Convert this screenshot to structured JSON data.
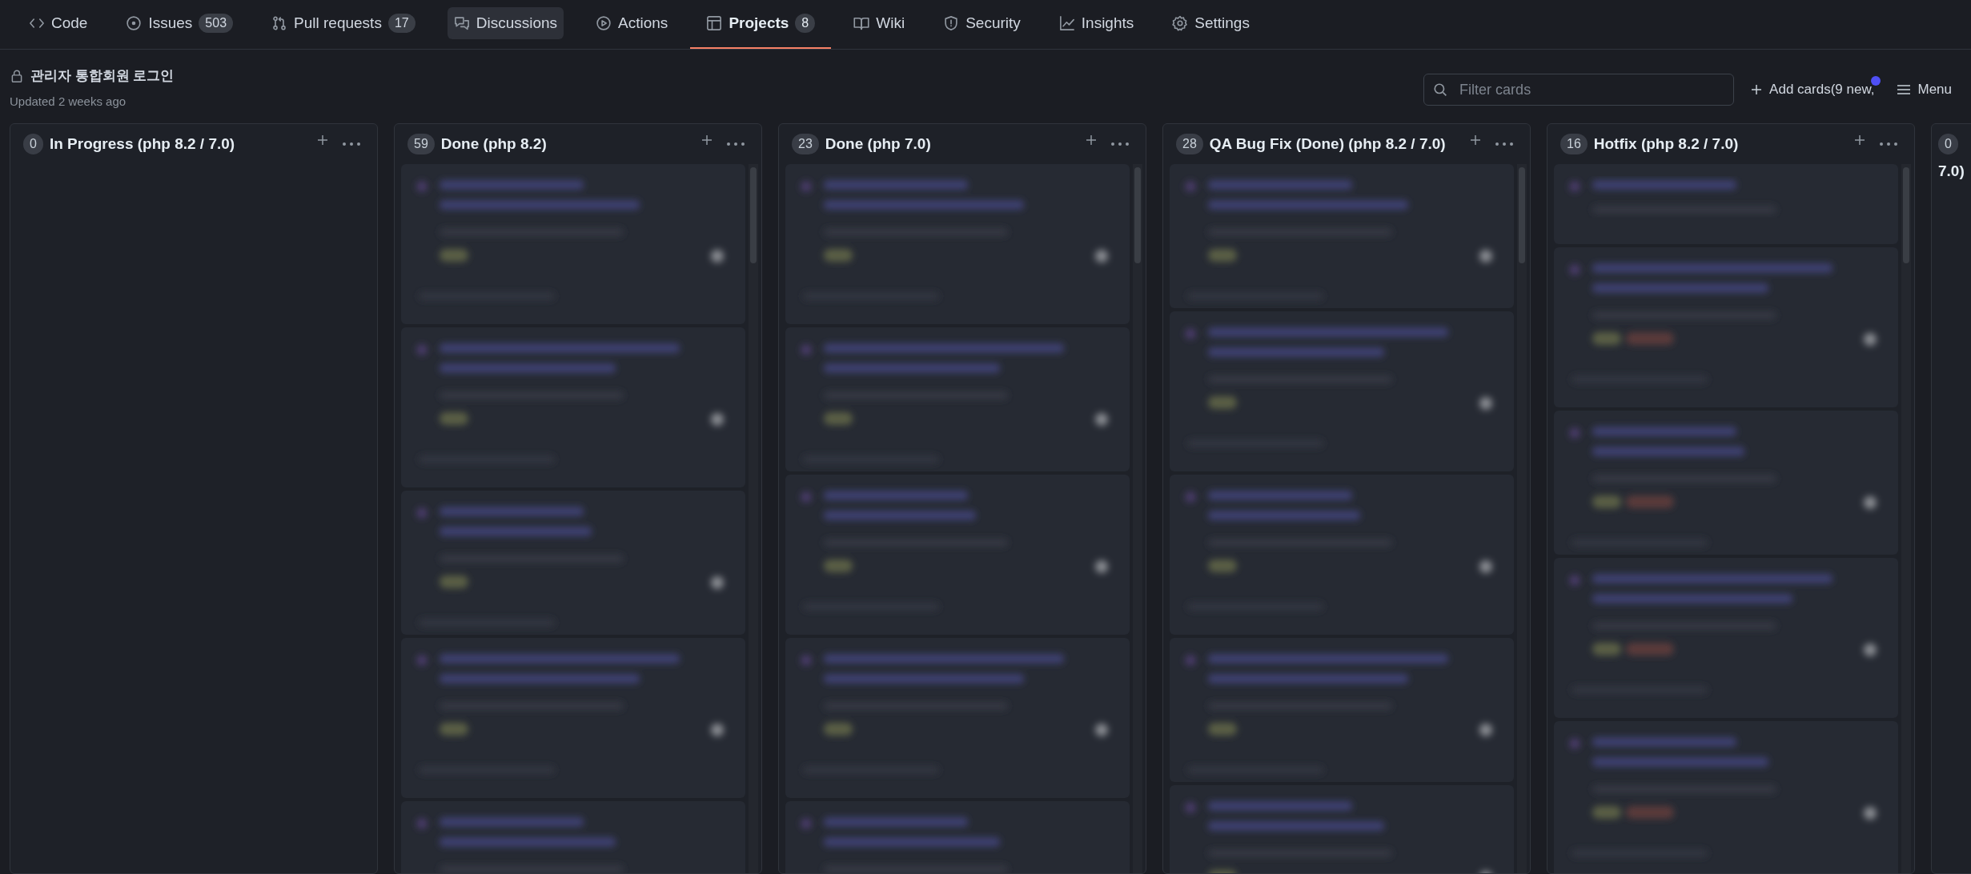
{
  "nav": [
    {
      "label": "Code",
      "selected": false,
      "highlighted": false
    },
    {
      "label": "Issues",
      "count": "503",
      "selected": false,
      "highlighted": false
    },
    {
      "label": "Pull requests",
      "count": "17",
      "selected": false,
      "highlighted": false
    },
    {
      "label": "Discussions",
      "selected": false,
      "highlighted": true
    },
    {
      "label": "Actions",
      "selected": false,
      "highlighted": false
    },
    {
      "label": "Projects",
      "count": "8",
      "selected": true,
      "highlighted": false
    },
    {
      "label": "Wiki",
      "selected": false,
      "highlighted": false
    },
    {
      "label": "Security",
      "selected": false,
      "highlighted": false
    },
    {
      "label": "Insights",
      "selected": false,
      "highlighted": false
    },
    {
      "label": "Settings",
      "selected": false,
      "highlighted": false
    }
  ],
  "project": {
    "title": "관리자 통합회원 로그인",
    "private": true,
    "updated": "Updated 2 weeks ago"
  },
  "toolbar": {
    "filter": {
      "placeholder": "Filter cards"
    },
    "add_cards": "Add cards(9 new,",
    "new_indicator": true,
    "menu": "Menu"
  },
  "columns": [
    {
      "count": "0",
      "title": "In Progress (php 8.2 / 7.0)"
    },
    {
      "count": "59",
      "title": "Done (php 8.2)"
    },
    {
      "count": "23",
      "title": "Done (php 7.0)"
    },
    {
      "count": "28",
      "title": "QA Bug Fix (Done) (php 8.2 / 7.0)"
    },
    {
      "count": "16",
      "title": "Hotfix (php 8.2 / 7.0)"
    },
    {
      "count": "0",
      "title": "7.0)"
    }
  ]
}
